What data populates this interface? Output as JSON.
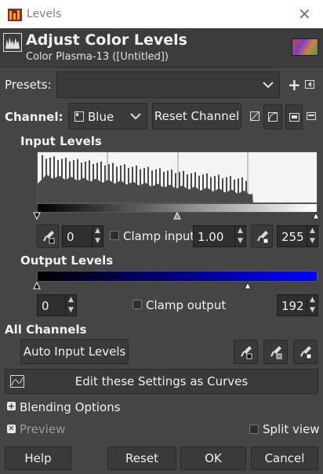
{
  "window": {
    "title": "Levels"
  },
  "header": {
    "title": "Adjust Color Levels",
    "subtitle": "Color Plasma-13 ([Untitled])"
  },
  "presets": {
    "label": "Presets:",
    "value": ""
  },
  "channel": {
    "label": "Channel:",
    "value": "Blue",
    "reset_label": "Reset Channel"
  },
  "input_levels": {
    "heading": "Input Levels",
    "low": "0",
    "gamma": "1.00",
    "high": "255",
    "clamp_label": "Clamp input",
    "clamp_checked": false
  },
  "output_levels": {
    "heading": "Output Levels",
    "low": "0",
    "high": "192",
    "clamp_label": "Clamp output",
    "clamp_checked": false,
    "gradient_color": "#0000ff"
  },
  "all_channels": {
    "heading": "All Channels",
    "auto_label": "Auto Input Levels"
  },
  "curves": {
    "label": "Edit these Settings as Curves"
  },
  "blending": {
    "label": "Blending Options"
  },
  "preview": {
    "label": "Preview",
    "checked": true,
    "split_label": "Split view",
    "split_checked": false
  },
  "footer": {
    "help": "Help",
    "reset": "Reset",
    "ok": "OK",
    "cancel": "Cancel"
  },
  "icons": [
    "levels-app-icon",
    "close-icon",
    "levels-dialog-icon",
    "chevron-down-icon",
    "add-preset-icon",
    "presets-menu-icon",
    "channel-icon",
    "linear-histogram-icon",
    "log-histogram-icon",
    "eyedropper-black-icon",
    "eyedropper-gray-icon",
    "eyedropper-white-icon",
    "curves-icon"
  ]
}
